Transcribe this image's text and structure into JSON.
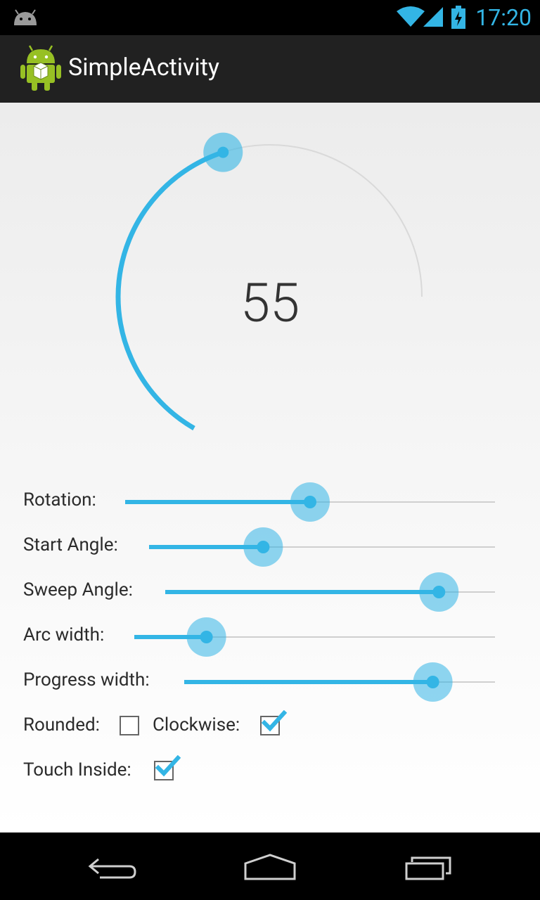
{
  "status_bar": {
    "time": "17:20",
    "icons": [
      "android-debug-icon",
      "wifi-icon",
      "signal-icon",
      "battery-charging-icon"
    ]
  },
  "action_bar": {
    "title": "SimpleActivity",
    "icon": "android-app-icon"
  },
  "arc": {
    "value": "55",
    "progress_fraction": 0.55,
    "colors": {
      "progress": "#33b5e5",
      "track": "#d9d9d9",
      "thumb": "#33b5e5"
    }
  },
  "controls": {
    "rotation": {
      "label": "Rotation:",
      "value_fraction": 0.5
    },
    "start_angle": {
      "label": "Start Angle:",
      "value_fraction": 0.33
    },
    "sweep_angle": {
      "label": "Sweep Angle:",
      "value_fraction": 0.83
    },
    "arc_width": {
      "label": "Arc width:",
      "value_fraction": 0.2
    },
    "progress_width": {
      "label": "Progress width:",
      "value_fraction": 0.8
    }
  },
  "options": {
    "rounded": {
      "label": "Rounded:",
      "checked": false
    },
    "clockwise": {
      "label": "Clockwise:",
      "checked": true
    },
    "touch_inside": {
      "label": "Touch Inside:",
      "checked": true
    }
  },
  "nav_bar": {
    "buttons": [
      "back-icon",
      "home-icon",
      "recent-apps-icon"
    ]
  }
}
